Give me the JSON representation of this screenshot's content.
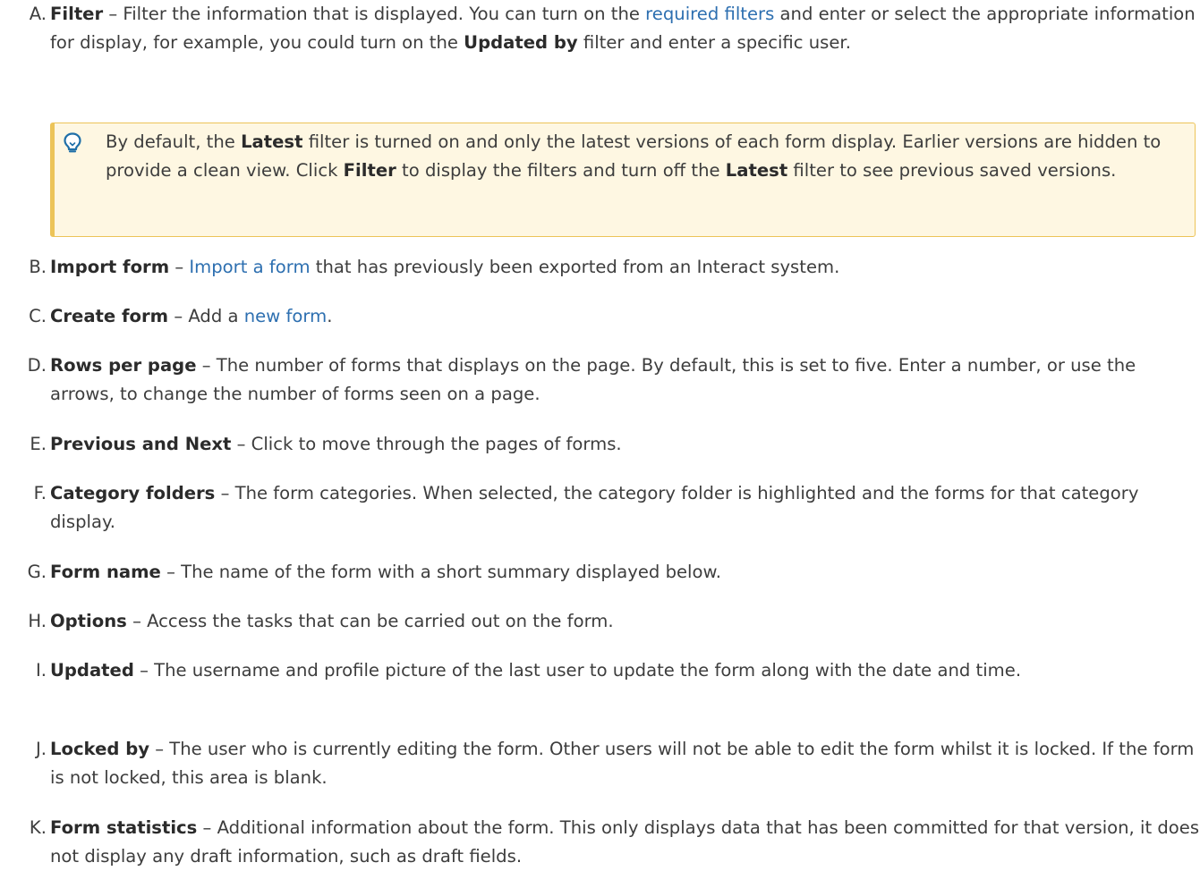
{
  "items": [
    {
      "letter": "A.",
      "term": "Filter",
      "parts": {
        "a": " – Filter the information that is displayed. You can turn on the ",
        "link": "required filters",
        "b": " and enter or select the appropriate information for display, for example, you could turn on the ",
        "bold": "Updated by",
        "c": " filter and enter a specific user."
      }
    },
    {
      "letter": "B.",
      "term": "Import form",
      "parts": {
        "a": " – ",
        "link": "Import a form",
        "b": " that has previously been exported from an Interact system."
      }
    },
    {
      "letter": "C.",
      "term": "Create form",
      "parts": {
        "a": " – Add a ",
        "link": "new form",
        "b": "."
      }
    },
    {
      "letter": "D.",
      "term": "Rows per page",
      "text": " – The number of forms that displays on the page. By default, this is set to five. Enter a number, or use the arrows, to change the number of forms seen on a page."
    },
    {
      "letter": "E.",
      "term": "Previous and Next",
      "text": " – Click to move through the pages of forms."
    },
    {
      "letter": "F.",
      "term": "Category folders",
      "text": " – The form categories. When selected, the category folder is highlighted and the forms for that category display."
    },
    {
      "letter": "G.",
      "term": "Form name",
      "text": " – The name of the form with a short summary displayed below."
    },
    {
      "letter": "H.",
      "term": "Options",
      "text": " – Access the tasks that can be carried out on the form."
    },
    {
      "letter": "I.",
      "term": "Updated",
      "text": " – The username and profile picture of the last user to update the form along with the date and time."
    },
    {
      "letter": "J.",
      "term": "Locked by",
      "text": " – The user who is currently editing the form. Other users will not be able to edit the form whilst it is locked. If the form is not locked, this area is blank."
    },
    {
      "letter": "K.",
      "term": "Form statistics",
      "text": " – Additional information about the form. This only displays data that has been committed for that version, it does not display any draft information, such as draft fields."
    }
  ],
  "tip": {
    "icon": "lightbulb-icon",
    "a": "By default, the ",
    "bold1": "Latest",
    "b": " filter is turned on and only the latest versions of each form display. Earlier versions are hidden to provide a clean view. Click ",
    "bold2": "Filter",
    "c": " to display the filters and turn off the ",
    "bold3": "Latest",
    "d": " filter to see previous saved versions."
  },
  "colors": {
    "link": "#2d6fb0",
    "tip_background": "#fef7e2",
    "tip_border": "#ecc458",
    "text": "#3d3d3d"
  }
}
